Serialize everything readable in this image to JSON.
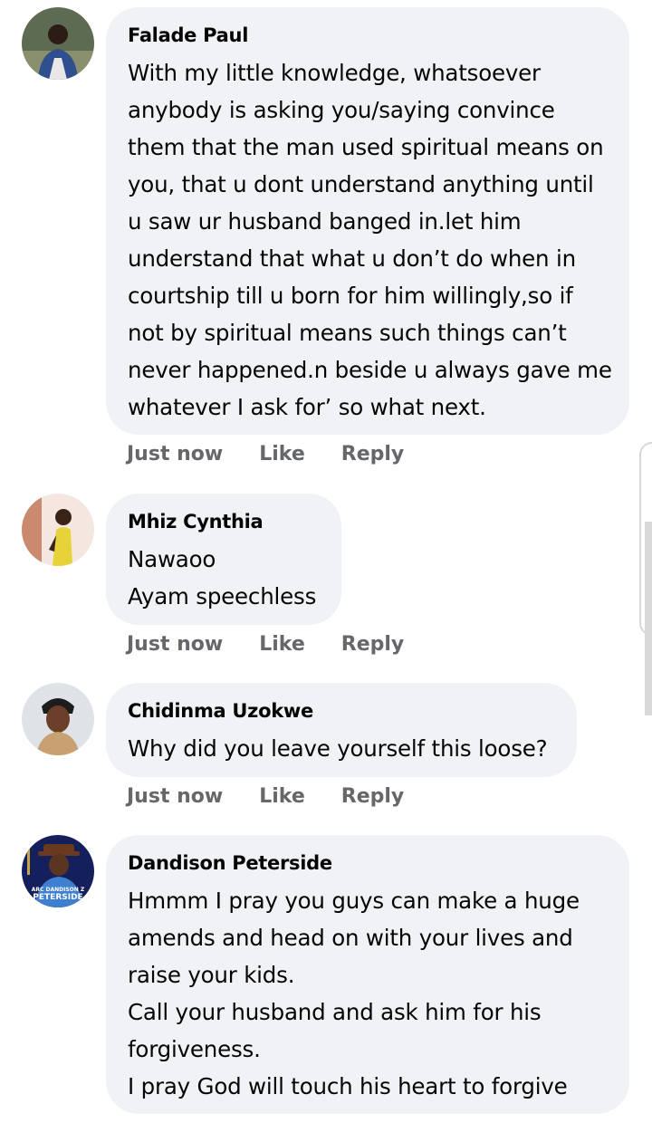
{
  "comments": [
    {
      "author": "Falade Paul",
      "lines": [
        "With my little knowledge, whatsoever",
        "anybody is asking you/saying convince",
        "them that the man used spiritual means on",
        "you, that u dont understand anything until",
        "u saw ur husband banged in.let him",
        "understand that what u don’t do when in",
        "courtship till u born for him willingly,so if",
        "not by spiritual means such things can’t",
        "never happened.n beside u always gave me",
        "whatever I ask for’ so what next."
      ],
      "time": "Just now",
      "like": "Like",
      "reply": "Reply"
    },
    {
      "author": "Mhiz Cynthia",
      "lines": [
        "Nawaoo",
        "Ayam speechless"
      ],
      "time": "Just now",
      "like": "Like",
      "reply": "Reply"
    },
    {
      "author": "Chidinma Uzokwe",
      "lines": [
        "Why did you leave yourself this loose?"
      ],
      "time": "Just now",
      "like": "Like",
      "reply": "Reply"
    },
    {
      "author": "Dandison Peterside",
      "avatar_text": [
        "ARC DANDISON Z",
        "PETERSIDE"
      ],
      "lines": [
        "Hmmm I pray you guys can make a huge",
        "amends and head on with your lives and",
        "raise your kids.",
        "Call your husband and ask him for his",
        "forgiveness.",
        "I pray God will touch his heart to forgive"
      ]
    }
  ]
}
